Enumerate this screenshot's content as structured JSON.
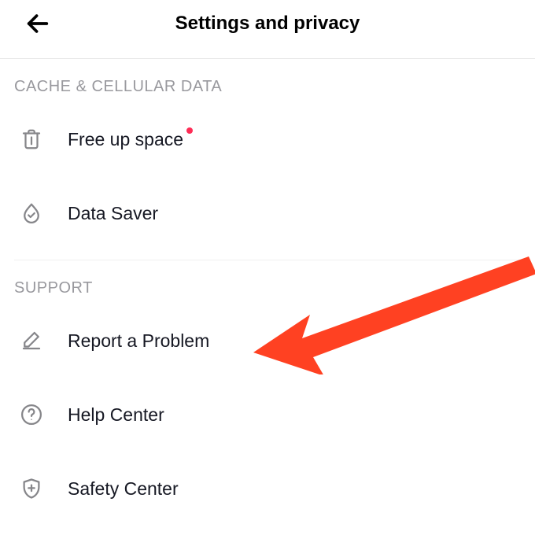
{
  "header": {
    "title": "Settings and privacy"
  },
  "sections": {
    "cache": {
      "header": "CACHE & CELLULAR DATA",
      "free_up_space": "Free up space",
      "data_saver": "Data Saver"
    },
    "support": {
      "header": "SUPPORT",
      "report_problem": "Report a Problem",
      "help_center": "Help Center",
      "safety_center": "Safety Center"
    }
  },
  "colors": {
    "accent": "#fe2c55",
    "icon": "#86868a",
    "section_header": "#99999e",
    "annotation": "#ff4122"
  }
}
